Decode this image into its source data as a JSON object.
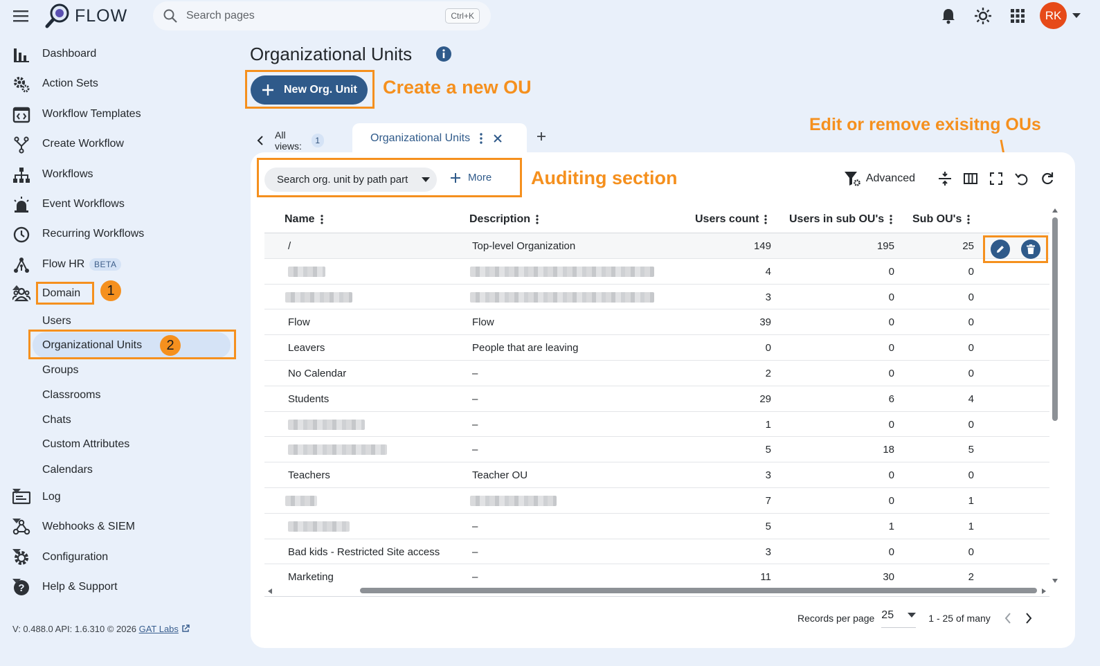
{
  "app": {
    "name": "FLOW"
  },
  "search": {
    "placeholder": "Search pages",
    "shortcut": "Ctrl+K"
  },
  "user": {
    "initials": "RK"
  },
  "colors": {
    "accent": "#2f5a8a",
    "highlight": "#f5901e",
    "background": "#e9f0fa",
    "avatar": "#e64a19"
  },
  "sidebar": {
    "items": [
      {
        "label": "Dashboard",
        "icon": "bar-chart-icon"
      },
      {
        "label": "Action Sets",
        "icon": "gears-icon"
      },
      {
        "label": "Workflow Templates",
        "icon": "code-window-icon"
      },
      {
        "label": "Create Workflow",
        "icon": "fork-icon"
      },
      {
        "label": "Workflows",
        "icon": "sitemap-icon"
      },
      {
        "label": "Event Workflows",
        "icon": "alarm-light-icon"
      },
      {
        "label": "Recurring Workflows",
        "icon": "clock-icon"
      },
      {
        "label": "Flow HR",
        "icon": "hierarchy-icon",
        "badge": "BETA"
      },
      {
        "label": "Domain",
        "icon": "people-icon"
      }
    ],
    "domain_sub": [
      "Users",
      "Organizational Units",
      "Groups",
      "Classrooms",
      "Chats",
      "Custom Attributes",
      "Calendars"
    ],
    "bottom_items": [
      {
        "label": "Log",
        "icon": "log-icon"
      },
      {
        "label": "Webhooks & SIEM",
        "icon": "webhook-icon"
      },
      {
        "label": "Configuration",
        "icon": "settings-icon"
      },
      {
        "label": "Help & Support",
        "icon": "help-icon"
      }
    ],
    "step1": "1",
    "step2": "2"
  },
  "footer": {
    "version": "V: 0.488.0   API: 1.6.310   © 2026",
    "link": "GAT Labs"
  },
  "page": {
    "title": "Organizational Units",
    "new_button": "New Org. Unit",
    "callout_create": "Create a new OU",
    "callout_audit": "Auditing section",
    "callout_edit": "Edit or remove exisitng OUs"
  },
  "views": {
    "all_label": "All views:",
    "count": "1",
    "active_tab": "Organizational Units"
  },
  "filters": {
    "search_chip": "Search org. unit by path part",
    "more": "More",
    "advanced": "Advanced"
  },
  "table": {
    "columns": [
      "Name",
      "Description",
      "Users count",
      "Users in sub OU's",
      "Sub OU's"
    ],
    "rows": [
      {
        "name": "/",
        "desc": "Top-level Organization",
        "users": "149",
        "sub_users": "195",
        "sub_ous": "25"
      },
      {
        "name": "",
        "desc": "",
        "users": "4",
        "sub_users": "0",
        "sub_ous": "0"
      },
      {
        "name": "",
        "desc": "",
        "users": "3",
        "sub_users": "0",
        "sub_ous": "0"
      },
      {
        "name": "Flow",
        "desc": "Flow",
        "users": "39",
        "sub_users": "0",
        "sub_ous": "0"
      },
      {
        "name": "Leavers",
        "desc": "People that are leaving",
        "users": "0",
        "sub_users": "0",
        "sub_ous": "0"
      },
      {
        "name": "No Calendar",
        "desc": "–",
        "users": "2",
        "sub_users": "0",
        "sub_ous": "0"
      },
      {
        "name": "Students",
        "desc": "–",
        "users": "29",
        "sub_users": "6",
        "sub_ous": "4"
      },
      {
        "name": "",
        "desc": "–",
        "users": "1",
        "sub_users": "0",
        "sub_ous": "0"
      },
      {
        "name": "",
        "desc": "–",
        "users": "5",
        "sub_users": "18",
        "sub_ous": "5"
      },
      {
        "name": "Teachers",
        "desc": "Teacher OU",
        "users": "3",
        "sub_users": "0",
        "sub_ous": "0"
      },
      {
        "name": "",
        "desc": "",
        "users": "7",
        "sub_users": "0",
        "sub_ous": "1"
      },
      {
        "name": "",
        "desc": "–",
        "users": "5",
        "sub_users": "1",
        "sub_ous": "1"
      },
      {
        "name": "Bad kids - Restricted Site access",
        "desc": "–",
        "users": "3",
        "sub_users": "0",
        "sub_ous": "0"
      },
      {
        "name": "Marketing",
        "desc": "–",
        "users": "11",
        "sub_users": "30",
        "sub_ous": "2"
      }
    ]
  },
  "pager": {
    "label": "Records per page",
    "per_page": "25",
    "range": "1 - 25 of many"
  }
}
